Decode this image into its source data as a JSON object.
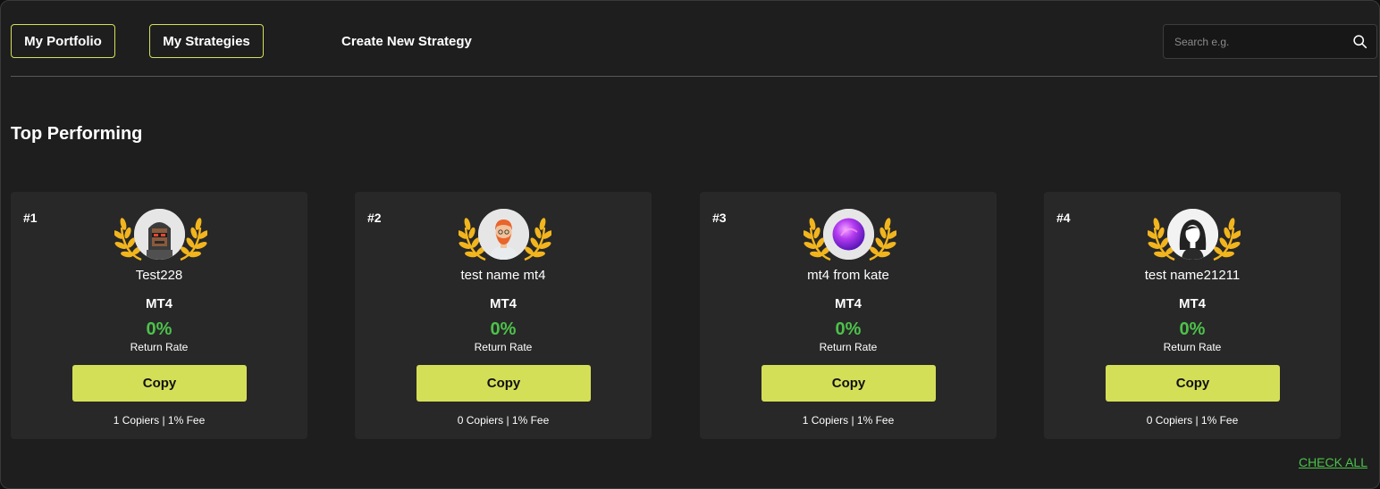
{
  "nav": {
    "portfolio_label": "My Portfolio",
    "strategies_label": "My Strategies",
    "create_label": "Create New Strategy"
  },
  "search": {
    "placeholder": "Search e.g.",
    "icon": "search-icon"
  },
  "section": {
    "title": "Top Performing"
  },
  "cards": [
    {
      "rank": "#1",
      "name": "Test228",
      "platform": "MT4",
      "rate": "0%",
      "rate_label": "Return Rate",
      "copy_label": "Copy",
      "meta": "1 Copiers | 1% Fee",
      "avatar": "pixel-hooded-avatar"
    },
    {
      "rank": "#2",
      "name": "test name mt4",
      "platform": "MT4",
      "rate": "0%",
      "rate_label": "Return Rate",
      "copy_label": "Copy",
      "meta": "0 Copiers | 1% Fee",
      "avatar": "bearded-man-avatar"
    },
    {
      "rank": "#3",
      "name": "mt4 from kate",
      "platform": "MT4",
      "rate": "0%",
      "rate_label": "Return Rate",
      "copy_label": "Copy",
      "meta": "1 Copiers | 1% Fee",
      "avatar": "purple-orb-avatar"
    },
    {
      "rank": "#4",
      "name": "test name21211",
      "platform": "MT4",
      "rate": "0%",
      "rate_label": "Return Rate",
      "copy_label": "Copy",
      "meta": "0 Copiers | 1% Fee",
      "avatar": "dark-hair-woman-avatar"
    }
  ],
  "footer": {
    "check_all_label": "CHECK ALL"
  },
  "colors": {
    "accent": "#d4df58",
    "positive": "#4cc24a",
    "laurel": "#f2b51d",
    "card": "#282828",
    "background": "#1e1e1e"
  }
}
